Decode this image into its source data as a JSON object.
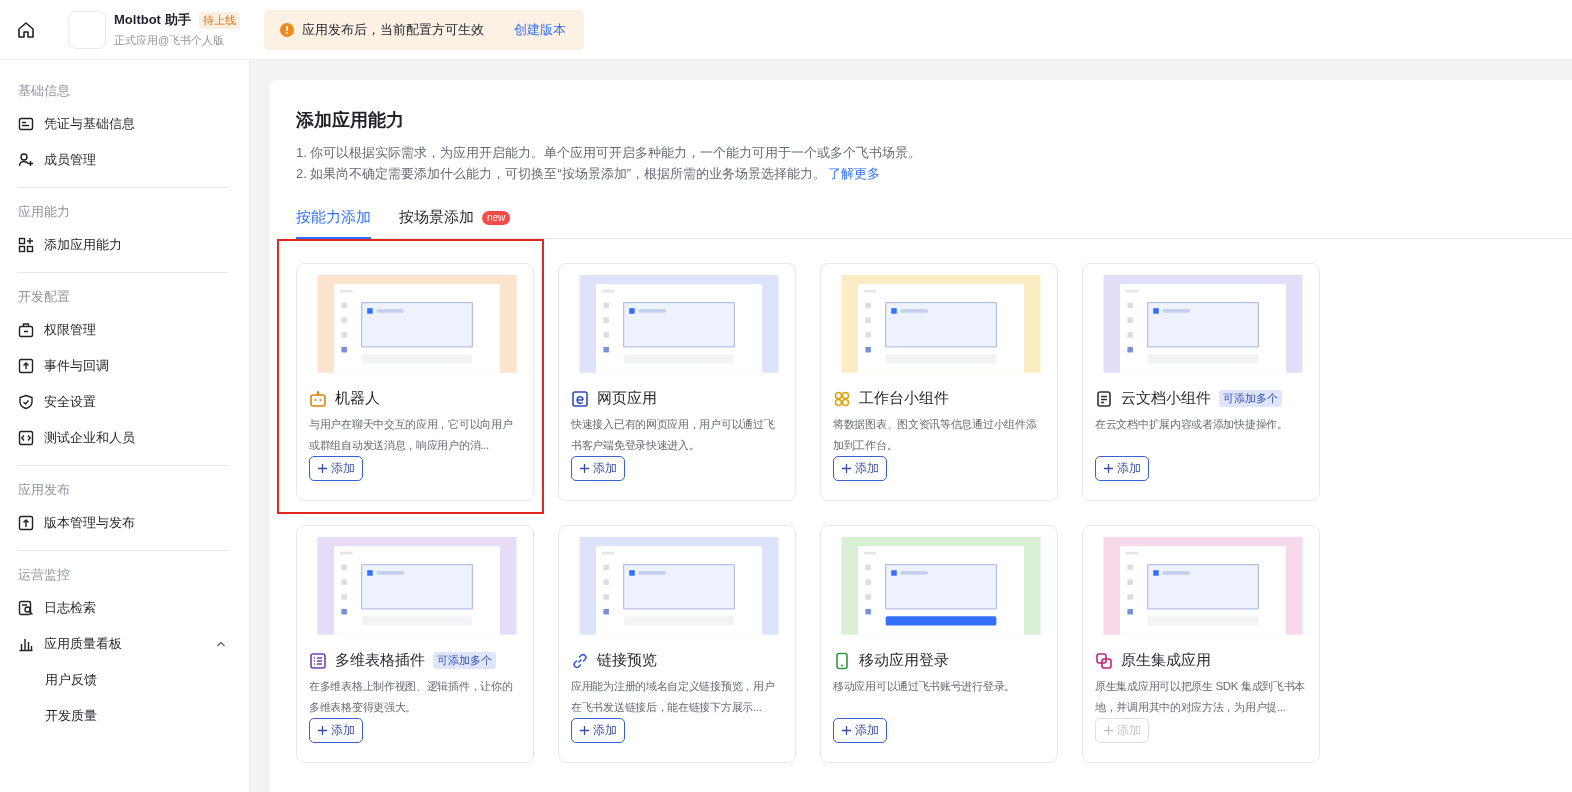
{
  "header": {
    "app_name": "Moltbot 助手",
    "status_tag": "待上线",
    "subtitle": "正式应用@飞书个人版"
  },
  "notice": {
    "text": "应用发布后，当前配置方可生效",
    "link": "创建版本"
  },
  "sidebar": {
    "sections": [
      {
        "title": "基础信息",
        "items": [
          {
            "label": "凭证与基础信息",
            "kind": "card",
            "selected": false
          },
          {
            "label": "成员管理",
            "kind": "members",
            "selected": false
          }
        ]
      },
      {
        "title": "应用能力",
        "items": [
          {
            "label": "添加应用能力",
            "kind": "apps",
            "selected": false
          }
        ]
      },
      {
        "title": "开发配置",
        "items": [
          {
            "label": "权限管理",
            "kind": "lock",
            "selected": false
          },
          {
            "label": "事件与回调",
            "kind": "event",
            "selected": false
          },
          {
            "label": "安全设置",
            "kind": "shield",
            "selected": false
          },
          {
            "label": "测试企业和人员",
            "kind": "code",
            "selected": false
          }
        ]
      },
      {
        "title": "应用发布",
        "items": [
          {
            "label": "版本管理与发布",
            "kind": "upload",
            "selected": false
          }
        ]
      },
      {
        "title": "运营监控",
        "items": [
          {
            "label": "日志检索",
            "kind": "log",
            "selected": false
          },
          {
            "label": "应用质量看板",
            "kind": "chart",
            "selected": false,
            "expanded": true,
            "children": [
              {
                "label": "用户反馈",
                "selected": false
              },
              {
                "label": "开发质量",
                "selected": false
              }
            ]
          }
        ]
      }
    ]
  },
  "main": {
    "title": "添加应用能力",
    "notes": [
      {
        "text": "1. 你可以根据实际需求，为应用开启能力。单个应用可开启多种能力，一个能力可用于一个或多个飞书场景。"
      },
      {
        "text": "2. 如果尚不确定需要添加什么能力，可切换至“按场景添加”，根据所需的业务场景选择能力。",
        "link": "了解更多"
      }
    ],
    "tabs": [
      {
        "label": "按能力添加",
        "selected": true
      },
      {
        "label": "按场景添加",
        "badge": "new",
        "selected": false
      }
    ],
    "cards": [
      {
        "kind": "bot",
        "title": "机器人",
        "description": "与用户在聊天中交互的应用，它可以向用户或群组自动发送消息，响应用户的消...",
        "button": "添加",
        "disabled": false,
        "highlighted": true
      },
      {
        "kind": "web",
        "title": "网页应用",
        "description": "快速接入已有的网页应用，用户可以通过飞书客户端免登录快速进入。",
        "button": "添加",
        "disabled": false,
        "highlighted": false
      },
      {
        "kind": "widget",
        "title": "工作台小组件",
        "description": "将数据图表、图文资讯等信息通过小组件添加到工作台。",
        "button": "添加",
        "disabled": false,
        "highlighted": false
      },
      {
        "kind": "doc",
        "title": "云文档小组件",
        "badge": "可添加多个",
        "description": "在云文档中扩展内容或者添加快捷操作。",
        "button": "添加",
        "disabled": false,
        "highlighted": false
      },
      {
        "kind": "table",
        "title": "多维表格插件",
        "badge": "可添加多个",
        "description": "在多维表格上制作视图、逻辑插件，让你的多维表格变得更强大。",
        "button": "添加",
        "disabled": false,
        "highlighted": false
      },
      {
        "kind": "link",
        "title": "链接预览",
        "description": "应用能为注册的域名自定义链接预览，用户在飞书发送链接后，能在链接下方展示...",
        "button": "添加",
        "disabled": false,
        "highlighted": false
      },
      {
        "kind": "mobile",
        "title": "移动应用登录",
        "description": "移动应用可以通过飞书账号进行登录。",
        "button": "添加",
        "disabled": false,
        "highlighted": false
      },
      {
        "kind": "native",
        "title": "原生集成应用",
        "description": "原生集成应用可以把原生 SDK 集成到飞书本地，并调用其中的对应方法，为用户提...",
        "button": "添加",
        "disabled": true,
        "highlighted": false
      }
    ]
  }
}
